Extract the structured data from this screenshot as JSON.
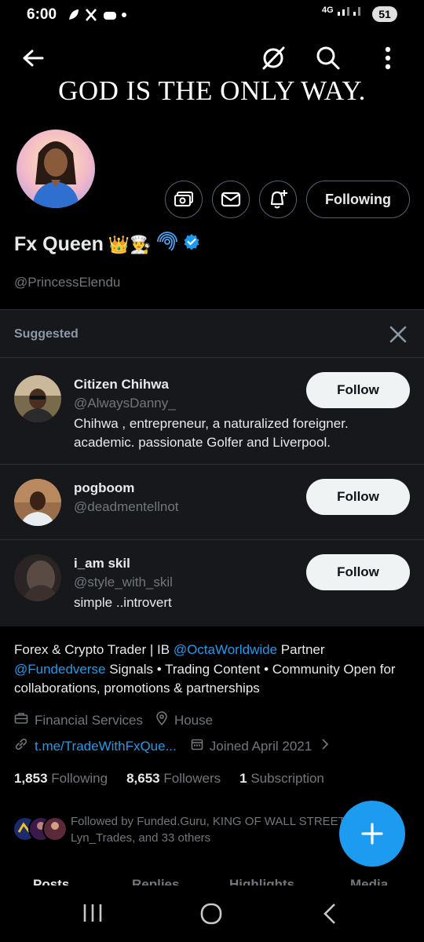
{
  "status_bar": {
    "time": "6:00",
    "network": "4G",
    "battery": "51"
  },
  "header": {
    "banner_text": "GOD IS THE ONLY WAY."
  },
  "profile": {
    "display_name": "Fx Queen",
    "name_emojis": "👑👨‍🍳",
    "handle": "@PrincessElendu",
    "following_button": "Following",
    "bio_parts": {
      "p1": "Forex & Crypto Trader | IB ",
      "mention1": "@OctaWorldwide",
      "p2": " Partner",
      "mention2": "@Fundedverse",
      "p3": " Signals • Trading Content • Community  Open for collaborations, promotions & partnerships"
    },
    "category": "Financial Services",
    "location": "House",
    "website": "t.me/TradeWithFxQue...",
    "joined": "Joined April 2021",
    "following_count": "1,853",
    "following_label": "Following",
    "followers_count": "8,653",
    "followers_label": "Followers",
    "subscription_count": "1",
    "subscription_label": "Subscription",
    "followed_by": "Followed by Funded.Guru, KING OF WALL STREET, Lyn_Trades, and 33 others"
  },
  "suggested": {
    "title": "Suggested",
    "users": [
      {
        "name": "Citizen Chihwa",
        "handle": "@AlwaysDanny_",
        "bio": "Chihwa , entrepreneur, a naturalized foreigner. academic. passionate Golfer and Liverpool.",
        "button": "Follow"
      },
      {
        "name": "pogboom",
        "handle": "@deadmentellnot",
        "bio": "",
        "button": "Follow"
      },
      {
        "name": "i_am skil",
        "handle": "@style_with_skil",
        "bio": "simple ..introvert",
        "button": "Follow"
      }
    ]
  },
  "tabs": [
    "Posts",
    "Replies",
    "Highlights",
    "Media"
  ],
  "colors": {
    "accent": "#1d9bf0",
    "background": "#000000",
    "panel": "#16181c",
    "muted": "#71767b"
  }
}
